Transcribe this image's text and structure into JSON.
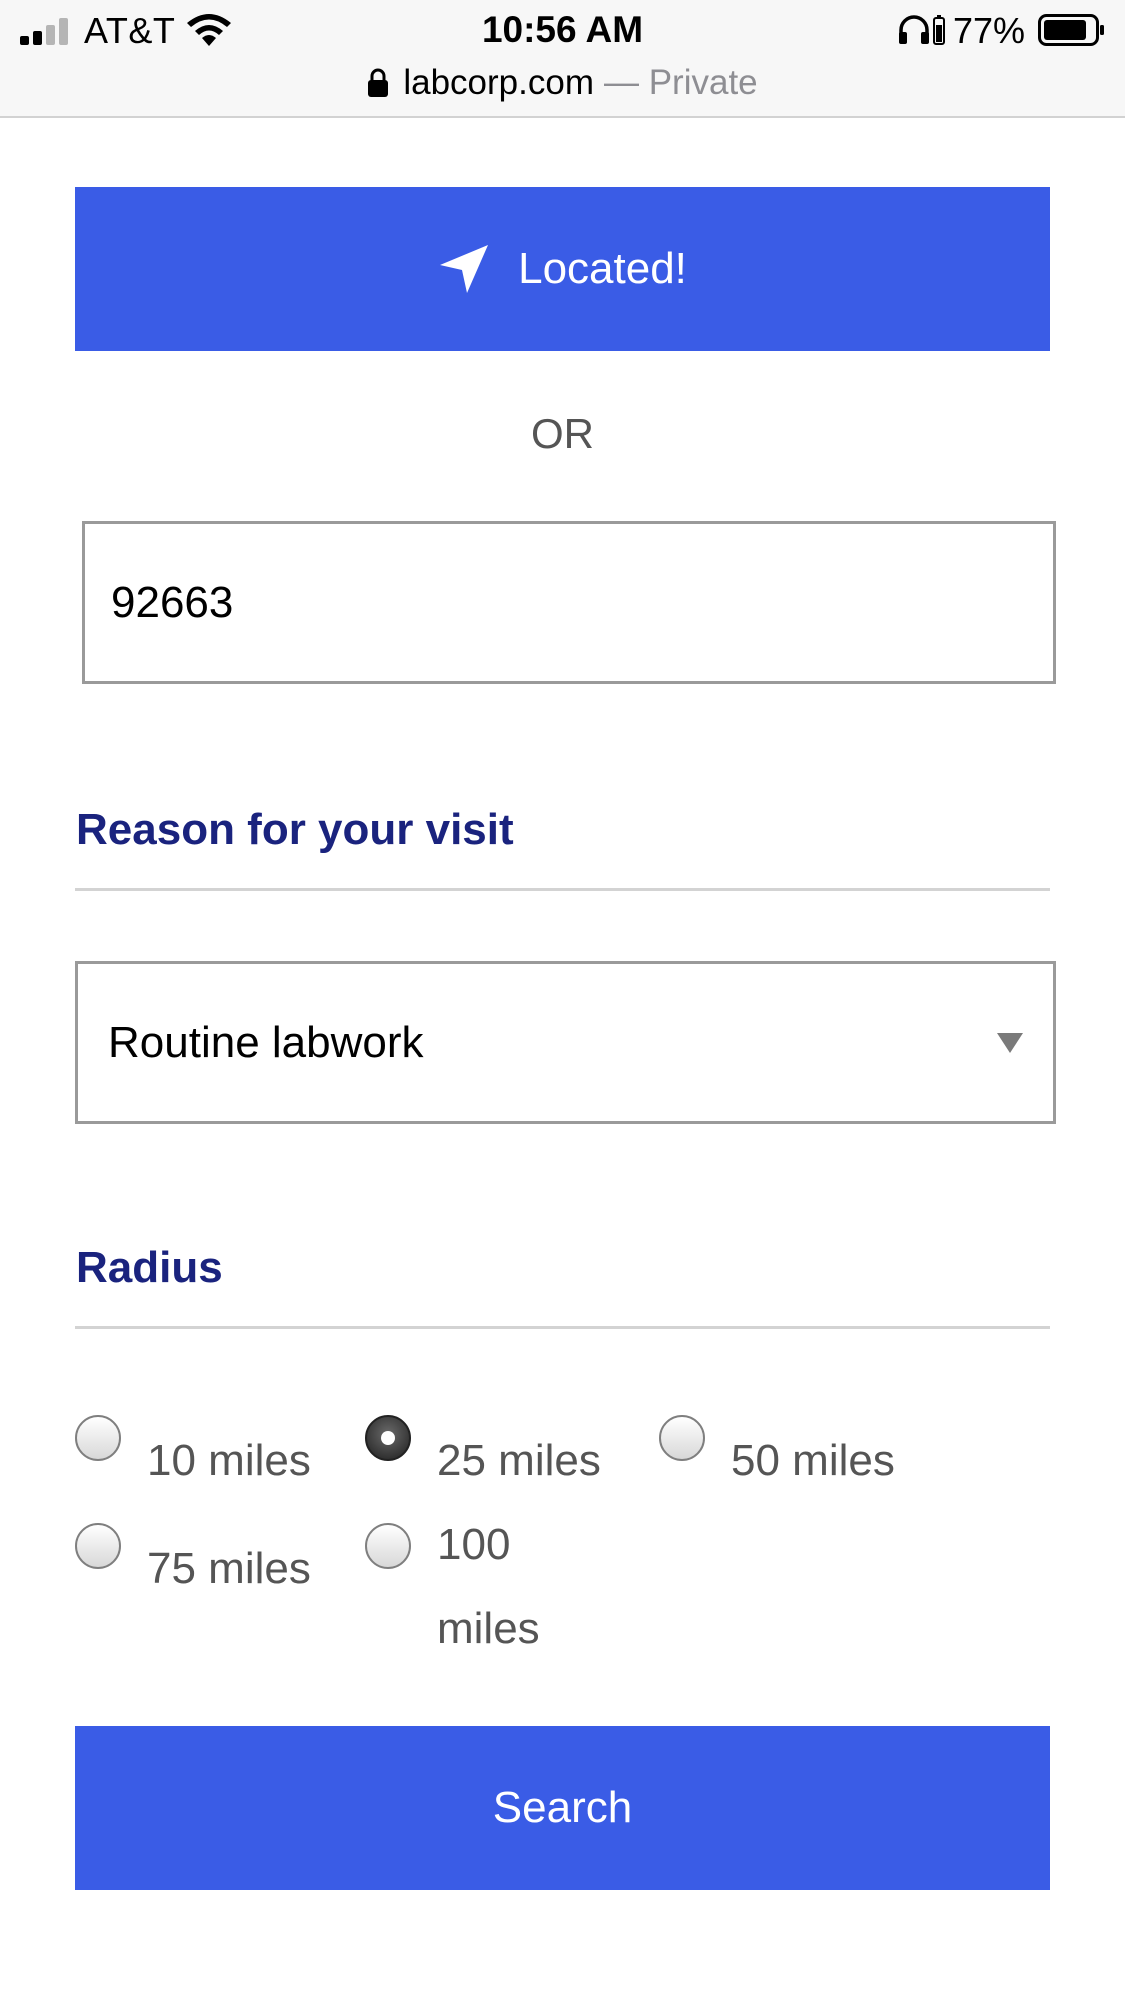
{
  "status_bar": {
    "carrier": "AT&T",
    "time": "10:56 AM",
    "battery_percent": "77%"
  },
  "url_bar": {
    "domain": "labcorp.com",
    "suffix": "— Private"
  },
  "location": {
    "located_label": "Located!",
    "or_label": "OR",
    "zip_value": "92663"
  },
  "reason": {
    "title": "Reason for your visit",
    "selected_value": "Routine labwork"
  },
  "radius": {
    "title": "Radius",
    "options": [
      {
        "label": "10 miles",
        "checked": false
      },
      {
        "label": "25 miles",
        "checked": true
      },
      {
        "label": "50 miles",
        "checked": false
      },
      {
        "label": "75 miles",
        "checked": false
      },
      {
        "label": "100 miles",
        "checked": false
      }
    ]
  },
  "search": {
    "label": "Search"
  },
  "colors": {
    "accent": "#3a5ce6",
    "heading": "#1a237e"
  },
  "icons": {
    "location": "location-arrow-icon",
    "dropdown": "dropdown-triangle-icon",
    "lock": "lock-icon"
  }
}
